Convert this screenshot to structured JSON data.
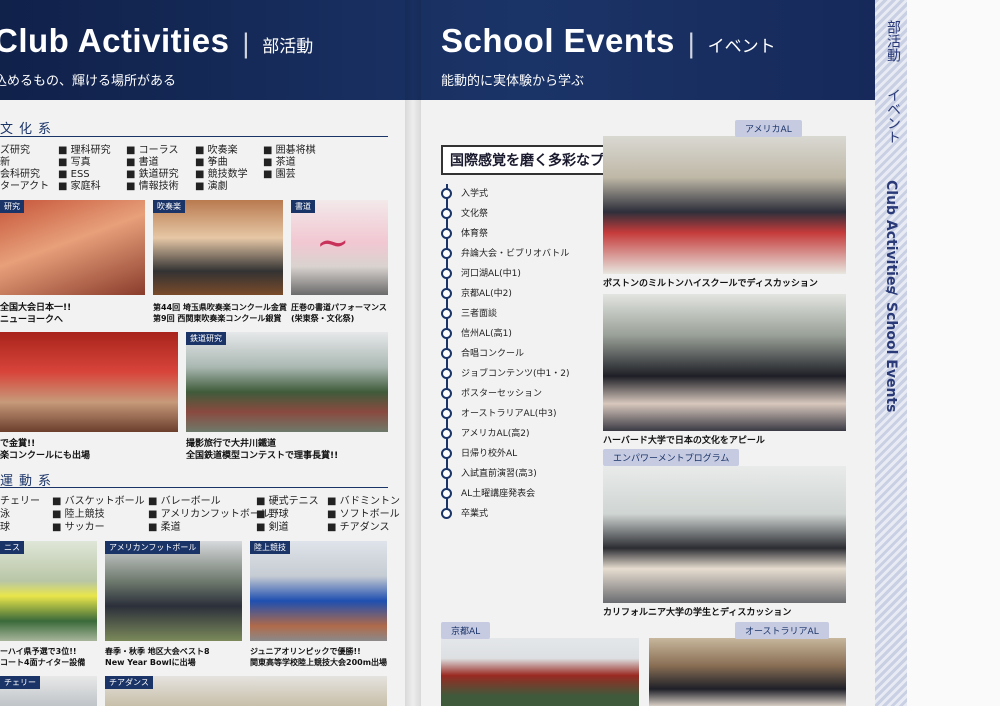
{
  "left_page": {
    "title": "Club Activities",
    "title_jp": "部活動",
    "subtitle": "込めるもの、輝ける場所がある",
    "culture": {
      "heading": "文化系",
      "items": [
        [
          "ズ研究",
          "新",
          "会科研究",
          "ターアクト"
        ],
        [
          "理科研究",
          "写真",
          "ESS",
          "家庭科"
        ],
        [
          "コーラス",
          "書道",
          "鉄道研究",
          "情報技術"
        ],
        [
          "吹奏楽",
          "筝曲",
          "競技数学",
          "演劇"
        ],
        [
          "囲碁将棋",
          "茶道",
          "園芸"
        ]
      ]
    },
    "photos_top": [
      {
        "tag": "研究",
        "cap1": "全国大会日本一!!",
        "cap2": "ニューヨークへ"
      },
      {
        "tag": "吹奏楽",
        "cap1": "第44回 埼玉県吹奏楽コンクール金賞",
        "cap2": "第9回 西関東吹奏楽コンクール銀賞"
      },
      {
        "tag": "書道",
        "cap1": "圧巻の書道パフォーマンス",
        "cap2": "(栄東祭・文化祭)"
      }
    ],
    "photos_mid": [
      {
        "tag": "",
        "cap1": "で金賞!!",
        "cap2": "楽コンクールにも出場"
      },
      {
        "tag": "鉄道研究",
        "cap1": "撮影旅行で大井川鐵道",
        "cap2": "全国鉄道模型コンテストで理事長賞!!"
      }
    ],
    "sports": {
      "heading": "運動系",
      "items": [
        [
          "チェリー",
          "泳",
          "球"
        ],
        [
          "バスケットボール",
          "陸上競技",
          "サッカー"
        ],
        [
          "バレーボール",
          "アメリカンフットボール",
          "柔道"
        ],
        [
          "硬式テニス",
          "野球",
          "剣道"
        ],
        [
          "バドミントン",
          "ソフトボール",
          "チアダンス"
        ]
      ]
    },
    "photos_bottom": [
      {
        "tag": "ニス",
        "cap1": "ーハイ県予選で3位!!",
        "cap2": "コート4面ナイター設備"
      },
      {
        "tag": "アメリカンフットボール",
        "cap1": "春季・秋季 地区大会ベスト8",
        "cap2": "New Year Bowlに出場"
      },
      {
        "tag": "陸上競技",
        "cap1": "ジュニアオリンピックで優勝!!",
        "cap2": "関東高等学校陸上競技大会200m出場"
      }
    ],
    "bottom_tags": [
      "チェリー",
      "チアダンス"
    ]
  },
  "right_page": {
    "title": "School Events",
    "title_jp": "イベント",
    "subtitle": "能動的に実体験から学ぶ",
    "program_title": "国際感覚を磨く多彩なプログラム",
    "events": [
      "入学式",
      "文化祭",
      "体育祭",
      "弁論大会・ビブリオバトル",
      "河口湖AL(中1)",
      "京都AL(中2)",
      "三者面談",
      "信州AL(高1)",
      "合唱コンクール",
      "ジョブコンテンツ(中1・2)",
      "ポスターセッション",
      "オーストラリアAL(中3)",
      "アメリカAL(高2)",
      "日帰り校外AL",
      "入試直前演習(高3)",
      "AL土曜講座発表会",
      "卒業式"
    ],
    "photos": [
      {
        "pill": "アメリカAL",
        "cap": "ボストンのミルトンハイスクールでディスカッション"
      },
      {
        "pill": "",
        "cap": "ハーバード大学で日本の文化をアピール"
      },
      {
        "pill": "エンパワーメントプログラム",
        "cap": "カリフォルニア大学の学生とディスカッション"
      },
      {
        "pill": "京都AL",
        "cap": ""
      },
      {
        "pill": "オーストラリアAL",
        "cap": ""
      }
    ]
  },
  "side_tab": {
    "top_jp": "部活動",
    "mid_jp": "イベント",
    "en1": "Club Activities",
    "en2": "School Events"
  }
}
